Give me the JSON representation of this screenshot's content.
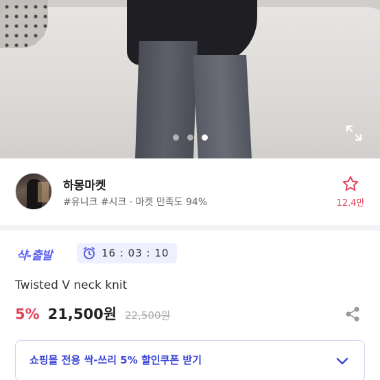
{
  "gallery": {
    "slide_count": 3,
    "active_slide": 3
  },
  "seller": {
    "name": "하몽마켓",
    "tags": "#유니크 #시크 · 마켓 만족도 94%",
    "favorite_count": "12.4만"
  },
  "product": {
    "badge": "샥-출발",
    "timer": "16 : 03 : 10",
    "name": "Twisted V neck knit",
    "discount": "5%",
    "price": "21,500원",
    "original_price": "22,500원"
  },
  "coupon": {
    "label": "쇼핑몰 전용 싹-쓰리 5% 할인쿠폰 받기"
  },
  "colors": {
    "accent": "#e2435a",
    "brand": "#5a5ef0",
    "coupon_text": "#3b45d8"
  },
  "icons": [
    "expand-icon",
    "star-icon",
    "clock-icon",
    "share-icon",
    "chevron-down-icon"
  ]
}
